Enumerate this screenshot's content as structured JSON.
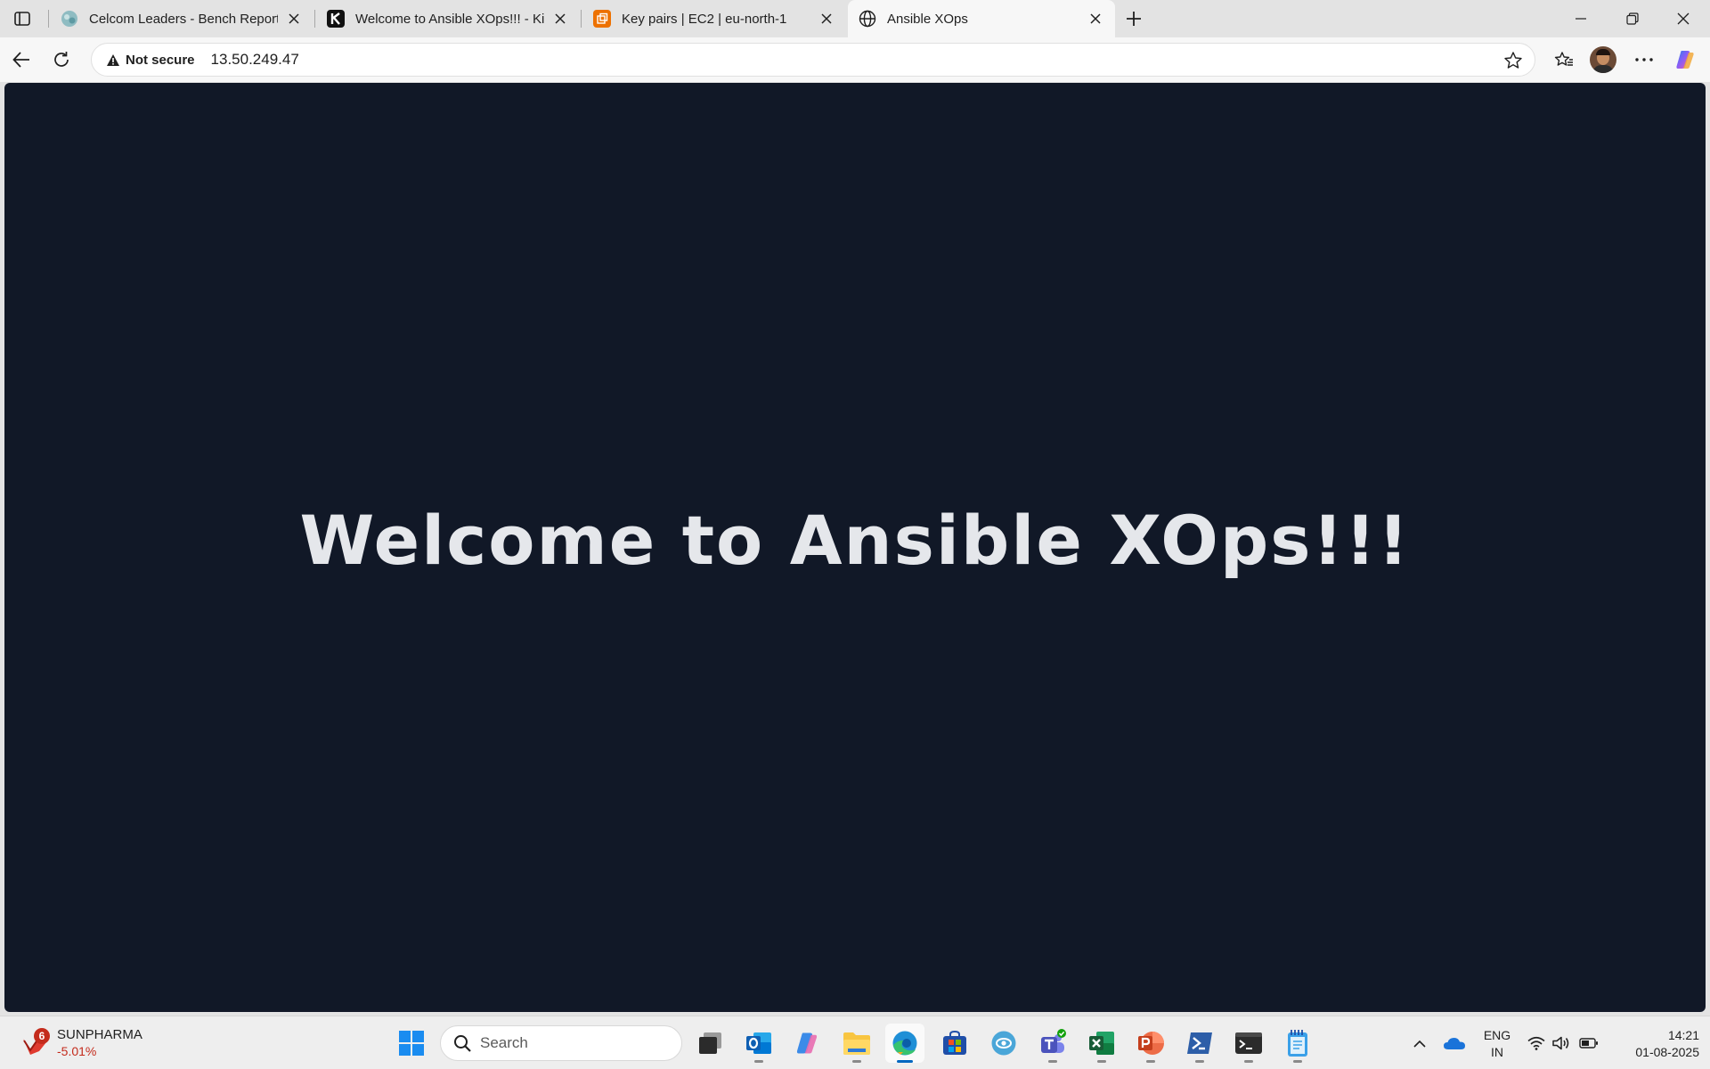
{
  "browser": {
    "tabs": [
      {
        "title": "Celcom Leaders - Bench Report -",
        "favicon": "globe-teal-icon",
        "active": false
      },
      {
        "title": "Welcome to Ansible XOps!!! - Kim",
        "favicon": "kimi-k-icon",
        "active": false
      },
      {
        "title": "Key pairs | EC2 | eu-north-1",
        "favicon": "aws-ec2-icon",
        "active": false
      },
      {
        "title": "Ansible XOps",
        "favicon": "globe-icon",
        "active": true
      }
    ],
    "address_bar": {
      "security_label": "Not secure",
      "url": "13.50.249.47"
    }
  },
  "page": {
    "heading": "Welcome to Ansible XOps!!!",
    "background_color": "#111827",
    "text_color": "#e5e7eb"
  },
  "taskbar": {
    "widget": {
      "name": "SUNPHARMA",
      "change": "-5.01%",
      "badge_count": "6"
    },
    "search_placeholder": "Search",
    "apps": [
      "windows-start-icon",
      "task-view-icon",
      "outlook-icon",
      "copilot-icon",
      "file-explorer-icon",
      "edge-icon",
      "store-icon",
      "vpn-icon",
      "teams-icon",
      "excel-icon",
      "powerpoint-icon",
      "powershell-icon",
      "terminal-icon",
      "notepad-icon"
    ],
    "tray": {
      "language_line1": "ENG",
      "language_line2": "IN",
      "time": "14:21",
      "date": "01-08-2025"
    }
  }
}
